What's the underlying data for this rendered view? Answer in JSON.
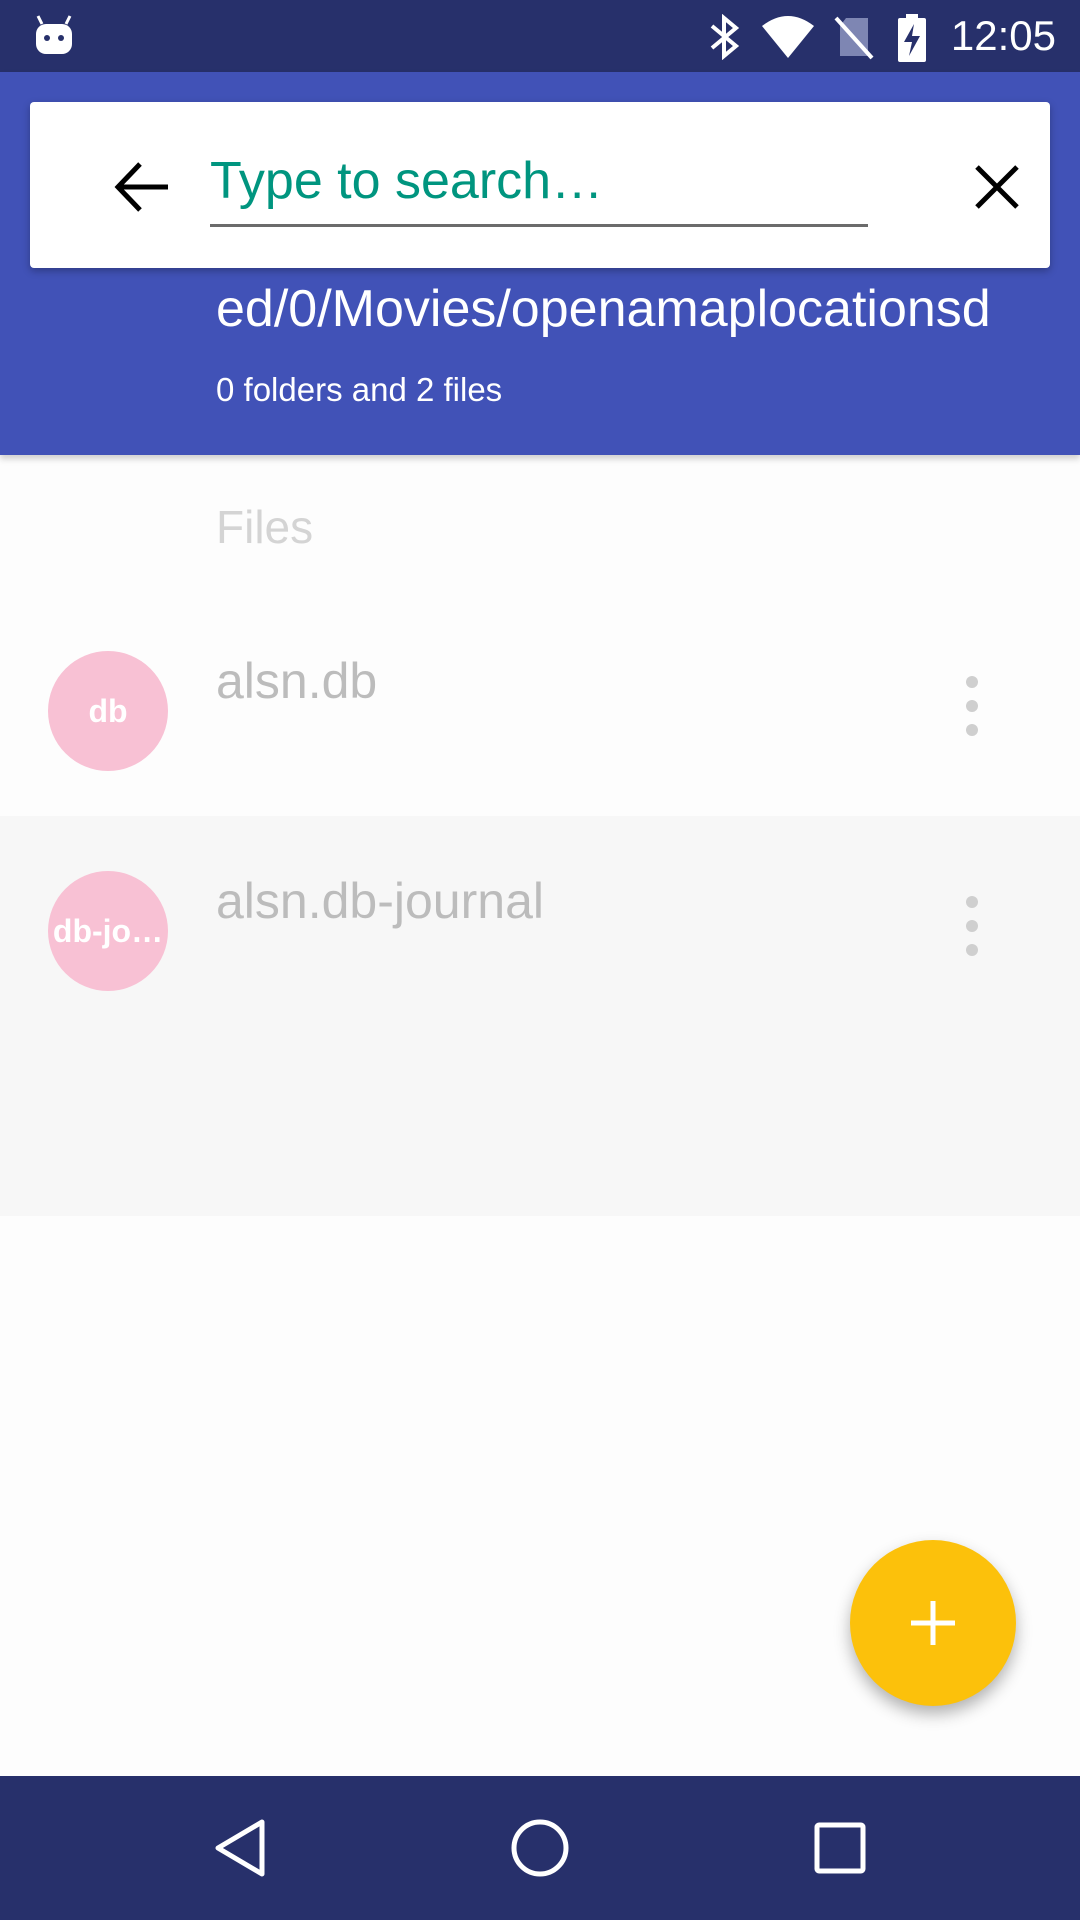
{
  "status_bar": {
    "time": "12:05",
    "icons": [
      "android-icon",
      "bluetooth-icon",
      "wifi-icon",
      "no-sim-icon",
      "battery-charging-icon"
    ]
  },
  "search": {
    "placeholder": "Type to search…",
    "value": ""
  },
  "header": {
    "path": "ed/0/Movies/openamaplocationsd",
    "summary": "0 folders and 2 files"
  },
  "section": {
    "label": "Files"
  },
  "files": [
    {
      "name": "alsn.db",
      "avatar_text": "db"
    },
    {
      "name": "alsn.db-journal",
      "avatar_text": "db-jo…"
    }
  ],
  "colors": {
    "status_bar": "#27306b",
    "app_bar": "#4152b7",
    "accent_teal": "#00897b",
    "avatar_pink": "#f8c1d4",
    "fab_yellow": "#fcc10b"
  }
}
